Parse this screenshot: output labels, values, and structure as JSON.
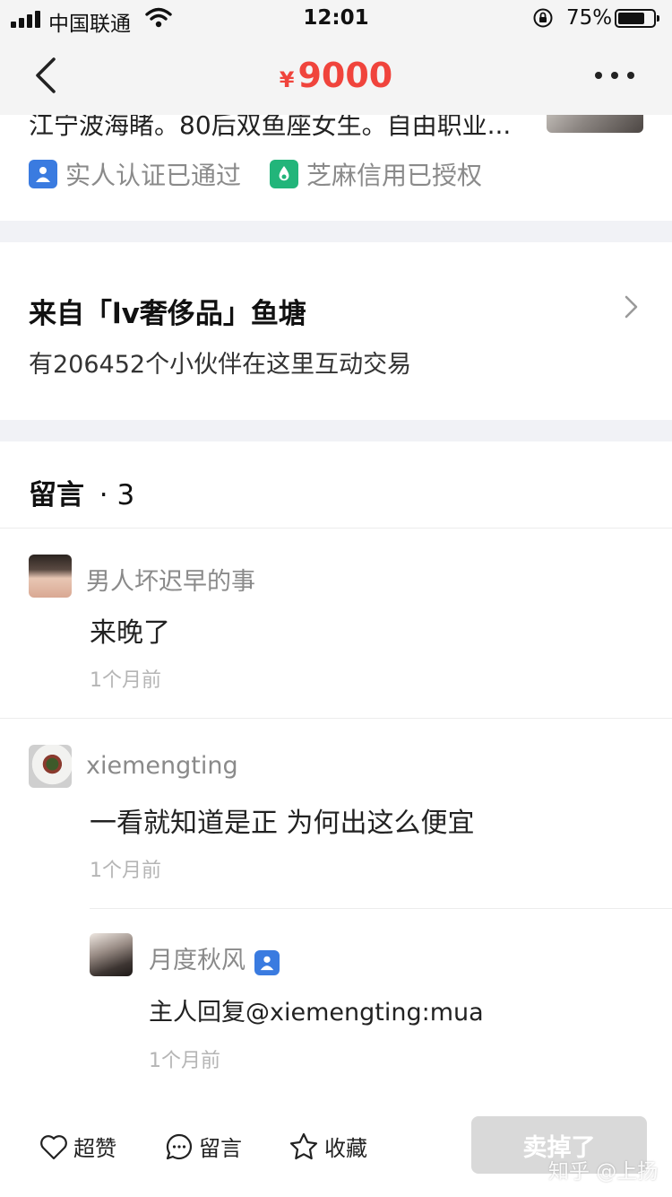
{
  "status_bar": {
    "carrier": "中国联通",
    "time": "12:01",
    "battery_percent": "75%",
    "battery_level": 0.75
  },
  "nav": {
    "currency": "¥",
    "price": "9000",
    "price_color": "#f0443c"
  },
  "seller": {
    "bio": "江宁波海睹。80后双鱼座女生。自由职业...",
    "badges": [
      {
        "label": "实人认证已通过",
        "icon": "person-verified-icon",
        "color": "#3a7be0"
      },
      {
        "label": "芝麻信用已授权",
        "icon": "sesame-credit-icon",
        "color": "#22b57a"
      }
    ]
  },
  "pond": {
    "title": "来自「lv奢侈品」鱼塘",
    "subtitle": "有206452个小伙伴在这里互动交易"
  },
  "comments": {
    "title": "留言",
    "count": "· 3",
    "items": [
      {
        "user": "男人坏迟早的事",
        "text": "来晚了",
        "time": "1个月前"
      },
      {
        "user": "xiemengting",
        "text": "一看就知道是正 为何出这么便宜",
        "time": "1个月前"
      },
      {
        "user": "月度秋风",
        "verified": true,
        "text": "主人回复@xiemengting:mua",
        "time": "1个月前"
      }
    ]
  },
  "bottom_bar": {
    "like_label": "超赞",
    "comment_label": "留言",
    "favorite_label": "收藏",
    "sold_label": "卖掉了"
  },
  "watermark": "知乎 @上扬"
}
